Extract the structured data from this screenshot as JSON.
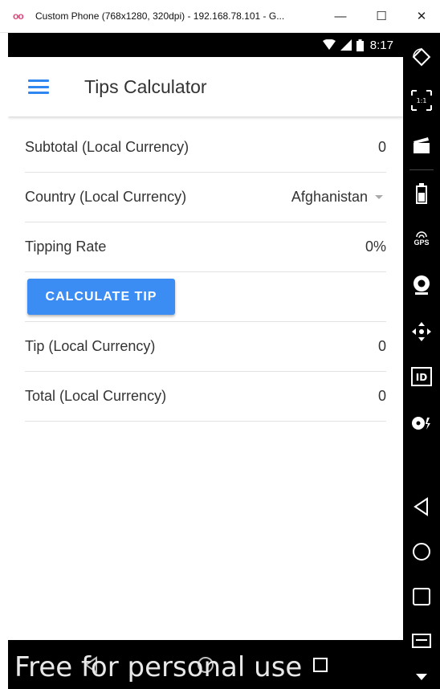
{
  "window": {
    "icon_text": "oo",
    "title": "Custom Phone (768x1280, 320dpi) - 192.168.78.101 - G...",
    "minimize": "—",
    "maximize": "☐",
    "close": "✕"
  },
  "status_bar": {
    "time": "8:17"
  },
  "app_bar": {
    "title": "Tips Calculator"
  },
  "form": {
    "subtotal_label": "Subtotal (Local Currency)",
    "subtotal_value": "0",
    "country_label": "Country (Local Currency)",
    "country_value": "Afghanistan",
    "tipping_rate_label": "Tipping Rate",
    "tipping_rate_value": "0%",
    "calculate_button": "CALCULATE TIP",
    "tip_label": "Tip (Local Currency)",
    "tip_value": "0",
    "total_label": "Total (Local Currency)",
    "total_value": "0"
  },
  "watermark": "Free for personal use",
  "colors": {
    "accent": "#3b8cf3",
    "menu_icon": "#2f86f0",
    "watermark_pink": "#e0457b"
  },
  "side_tools": [
    "rotate-icon",
    "pixel-perfect-icon",
    "screencast-icon",
    "battery-icon",
    "gps-icon",
    "camera-icon",
    "dpad-icon",
    "id-icon",
    "media-icon",
    "back-icon",
    "home-icon",
    "recents-icon",
    "menu-icon",
    "more-icon"
  ],
  "side_labels": {
    "pixel": "1:1",
    "gps": "GPS",
    "id": "ID"
  }
}
